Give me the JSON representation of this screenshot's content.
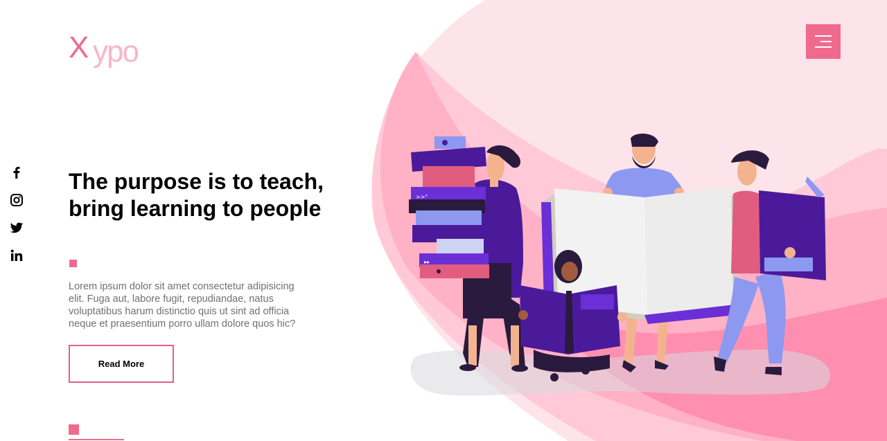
{
  "brand": {
    "logo_first": "X",
    "logo_rest": "ypo"
  },
  "header": {
    "menu_icon": "hamburger-menu-icon"
  },
  "social": [
    {
      "name": "facebook",
      "icon": "facebook-icon"
    },
    {
      "name": "instagram",
      "icon": "instagram-icon"
    },
    {
      "name": "twitter",
      "icon": "twitter-icon"
    },
    {
      "name": "linkedin",
      "icon": "linkedin-icon"
    }
  ],
  "hero": {
    "title": "The purpose is to teach, bring learning to people",
    "paragraph": "Lorem ipsum dolor sit amet consectetur adipisicing elit. Fuga aut, labore fugit, repudiandae, natus voluptatibus harum distinctio quis ut sint ad officia neque et praesentium porro ullam dolore quos hic?",
    "cta_label": "Read More"
  },
  "illustration": {
    "book_spine_marks": [
      ">>°",
      "▸▸"
    ]
  },
  "colors": {
    "accent": "#f06a8e",
    "blob_light": "#fde4ea",
    "blob_mid": "#ffc9d8",
    "blob_deep": "#ff8fb1",
    "purple": "#4b1a9b"
  }
}
